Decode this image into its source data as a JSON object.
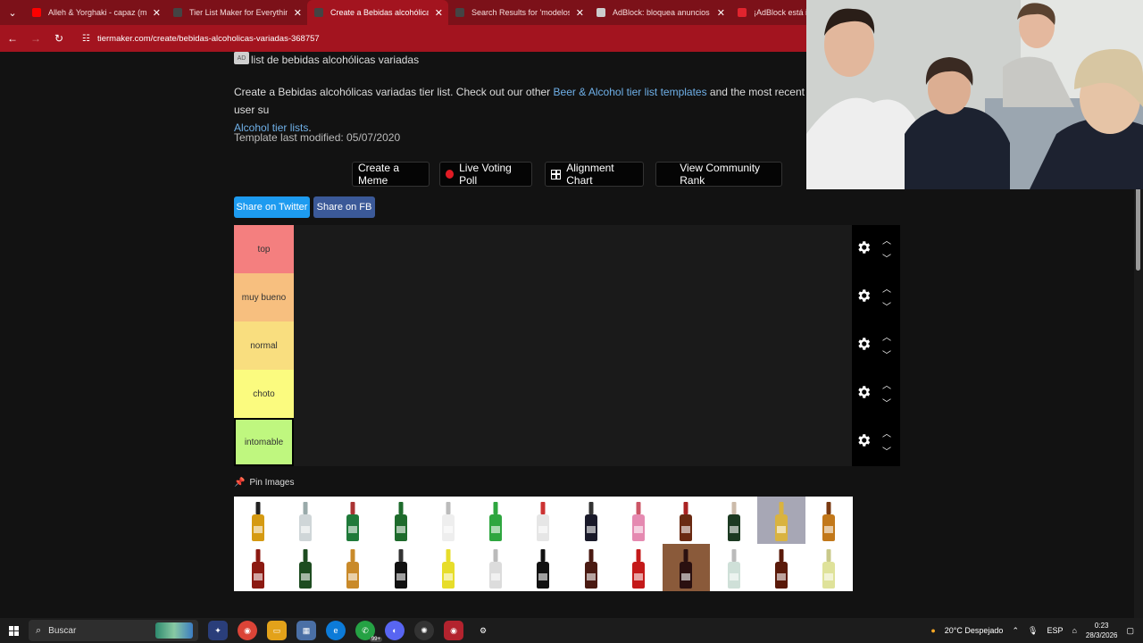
{
  "browser": {
    "tabs": [
      {
        "title": "Alleh & Yorghaki - capaz (mere",
        "color": "#ff0000"
      },
      {
        "title": "Tier List Maker for Everything -",
        "color": "#444444"
      },
      {
        "title": "Create a Bebidas alcohólicas va",
        "color": "#444444",
        "active": true
      },
      {
        "title": "Search Results for 'modelos' - T",
        "color": "#444444"
      },
      {
        "title": "AdBlock: bloquea anuncios en",
        "color": "#cccccc"
      },
      {
        "title": "¡AdBlock está inst",
        "color": "#e0242e"
      }
    ],
    "url": "tiermaker.com/create/bebidas-alcoholicas-variadas-368757"
  },
  "page": {
    "ad_badge": "AD",
    "title": "list de bebidas alcohólicas variadas",
    "desc_part1": "Create a Bebidas alcohólicas variadas tier list. Check out our other ",
    "desc_link1": "Beer & Alcohol tier list templates",
    "desc_part2": " and the most recent user su",
    "desc_link2": "Alcohol tier lists",
    "desc_part3": ".",
    "modified": "Template last modified: 05/07/2020",
    "buttons": {
      "meme": "Create a Meme",
      "poll": "Live Voting Poll",
      "alignment": "Alignment Chart",
      "community": "View Community Rank"
    },
    "share_twitter": "Share on Twitter",
    "share_fb": "Share on FB",
    "tiers": [
      {
        "label": "top",
        "color": "#f47f7f"
      },
      {
        "label": "muy bueno",
        "color": "#f7bf7f"
      },
      {
        "label": "normal",
        "color": "#f9de7f"
      },
      {
        "label": "choto",
        "color": "#fbfb7f"
      },
      {
        "label": "intomable",
        "color": "#bff77f"
      }
    ],
    "pin_images": "Pin Images"
  },
  "taskbar": {
    "search": "Buscar",
    "weather": "20°C  Despejado",
    "lang": "ESP",
    "time": "0:23",
    "date": "28/3/2026",
    "badge": "99+"
  }
}
